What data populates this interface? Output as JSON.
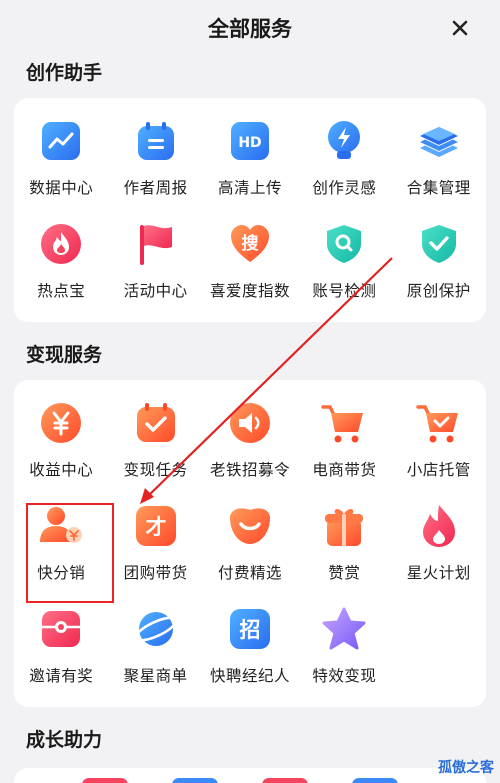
{
  "header": {
    "title": "全部服务"
  },
  "sections": [
    {
      "title": "创作助手",
      "items": [
        {
          "label": "数据中心",
          "icon": "chart-icon"
        },
        {
          "label": "作者周报",
          "icon": "calendar-icon"
        },
        {
          "label": "高清上传",
          "icon": "hd-icon"
        },
        {
          "label": "创作灵感",
          "icon": "bulb-icon"
        },
        {
          "label": "合集管理",
          "icon": "layers-icon"
        },
        {
          "label": "热点宝",
          "icon": "flame-icon"
        },
        {
          "label": "活动中心",
          "icon": "flag-icon"
        },
        {
          "label": "喜爱度指数",
          "icon": "search-heart-icon"
        },
        {
          "label": "账号检测",
          "icon": "shield-search-icon"
        },
        {
          "label": "原创保护",
          "icon": "shield-check-icon"
        }
      ]
    },
    {
      "title": "变现服务",
      "items": [
        {
          "label": "收益中心",
          "icon": "yuan-icon"
        },
        {
          "label": "变现任务",
          "icon": "task-icon"
        },
        {
          "label": "老铁招募令",
          "icon": "speaker-icon"
        },
        {
          "label": "电商带货",
          "icon": "cart-icon"
        },
        {
          "label": "小店托管",
          "icon": "cart-check-icon"
        },
        {
          "label": "快分销",
          "icon": "user-yuan-icon"
        },
        {
          "label": "团购带货",
          "icon": "group-buy-icon"
        },
        {
          "label": "付费精选",
          "icon": "smile-icon"
        },
        {
          "label": "赞赏",
          "icon": "gift-icon"
        },
        {
          "label": "星火计划",
          "icon": "fire-icon"
        },
        {
          "label": "邀请有奖",
          "icon": "invite-icon"
        },
        {
          "label": "聚星商单",
          "icon": "planet-icon"
        },
        {
          "label": "快聘经纪人",
          "icon": "recruit-icon"
        },
        {
          "label": "特效变现",
          "icon": "star-icon"
        }
      ]
    },
    {
      "title": "成长助力",
      "items": []
    }
  ],
  "icon_glyphs": {
    "hd": "HD",
    "recruit": "招",
    "search": "搜",
    "group": "才"
  },
  "watermark": "孤傲之客",
  "colors": {
    "blue": "#3b8af7",
    "red": "#f5445e",
    "orange": "#ff6b3d",
    "purple": "#8b6cf6",
    "highlight": "#e22222"
  }
}
